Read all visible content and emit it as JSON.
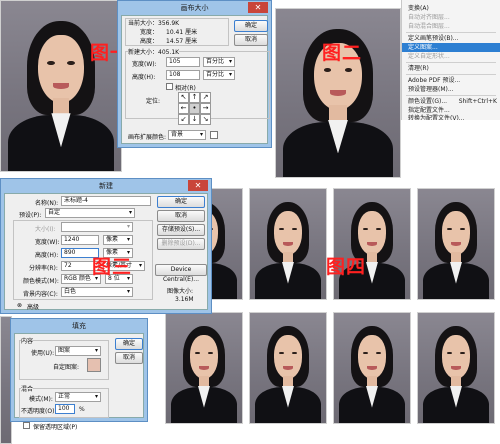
{
  "labels": {
    "fig1": "图一",
    "fig2": "图二",
    "fig3": "图三",
    "fig4": "图四"
  },
  "canvas_dialog": {
    "title": "画布大小",
    "current_size": "当前大小：356.9K",
    "cur_width_label": "宽度：",
    "cur_width": "10.41 厘米",
    "cur_height_label": "高度：",
    "cur_height": "14.57 厘米",
    "new_size": "新建大小：405.1K",
    "width_label": "宽度(W):",
    "width_value": "105",
    "width_unit": "百分比",
    "height_label": "高度(H):",
    "height_value": "108",
    "height_unit": "百分比",
    "relative_label": "相对(R)",
    "anchor_label": "定位:",
    "ext_color_label": "画布扩展颜色:",
    "ext_color_value": "背景",
    "ok": "确定",
    "cancel": "取消"
  },
  "menu": {
    "items": [
      {
        "label": "变换(A)",
        "state": "normal"
      },
      {
        "label": "自动对齐图层...",
        "state": "disabled"
      },
      {
        "label": "自动混合图层...",
        "state": "disabled"
      },
      {
        "label": "定义画笔预设(B)...",
        "state": "normal"
      },
      {
        "label": "定义图案...",
        "state": "selected"
      },
      {
        "label": "定义自定形状...",
        "state": "disabled"
      },
      {
        "label": "清理(R)",
        "state": "normal"
      },
      {
        "label": "Adobe PDF 预设...",
        "state": "normal"
      },
      {
        "label": "预设管理器(M)...",
        "state": "normal"
      },
      {
        "label": "颜色设置(G)...",
        "state": "normal",
        "shortcut": "Shift+Ctrl+K"
      },
      {
        "label": "指定配置文件...",
        "state": "normal"
      },
      {
        "label": "转换为配置文件(V)...",
        "state": "normal"
      }
    ]
  },
  "new_dialog": {
    "title": "新建",
    "name_label": "名称(N):",
    "name_value": "未标题-4",
    "preset_label": "预设(P):",
    "preset_value": "自定",
    "size_label": "大小(I):",
    "width_label": "宽度(W):",
    "width_value": "1240",
    "width_unit": "像素",
    "height_label": "高度(H):",
    "height_value": "890",
    "height_unit": "像素",
    "res_label": "分辨率(R):",
    "res_value": "72",
    "res_unit": "像素/英寸",
    "mode_label": "颜色模式(M):",
    "mode_value": "RGB 颜色",
    "mode_bits": "8 位",
    "bg_label": "背景内容(C):",
    "bg_value": "白色",
    "advanced_label": "高级",
    "image_size_label": "图像大小:",
    "image_size_value": "3.16M",
    "ok": "确定",
    "cancel": "取消",
    "save_preset": "存储预设(S)...",
    "delete_preset": "删除预设(D)...",
    "device_central": "Device Central(E)..."
  },
  "fill_dialog": {
    "title": "填充",
    "content_group": "内容",
    "use_label": "使用(U):",
    "use_value": "图案",
    "custom_pattern_label": "自定图案:",
    "blend_group": "混合",
    "mode_label": "模式(M):",
    "mode_value": "正常",
    "opacity_label": "不透明度(O):",
    "opacity_value": "100",
    "opacity_unit": "%",
    "preserve_label": "保留透明区域(P)",
    "ok": "确定",
    "cancel": "取消"
  }
}
